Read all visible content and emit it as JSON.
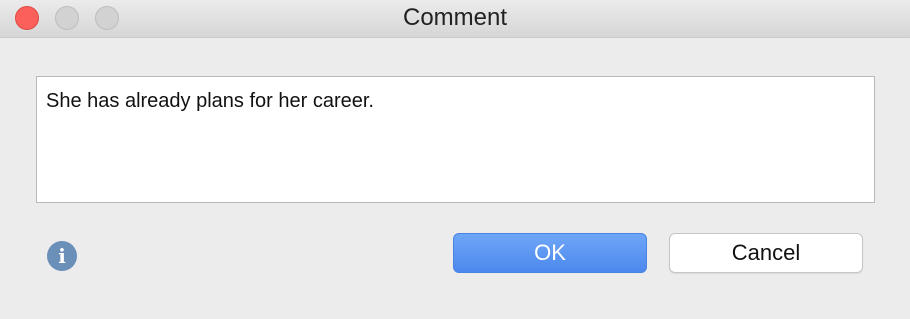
{
  "window": {
    "title": "Comment",
    "controls": {
      "close_color": "#fc605b",
      "minimize_color": "#d2d2d2",
      "maximize_color": "#d2d2d2"
    }
  },
  "comment": {
    "text": "She has already plans for her career."
  },
  "info": {
    "icon": "info-icon",
    "glyph": "i"
  },
  "buttons": {
    "ok_label": "OK",
    "cancel_label": "Cancel",
    "accent_color": "#4c88ee"
  }
}
